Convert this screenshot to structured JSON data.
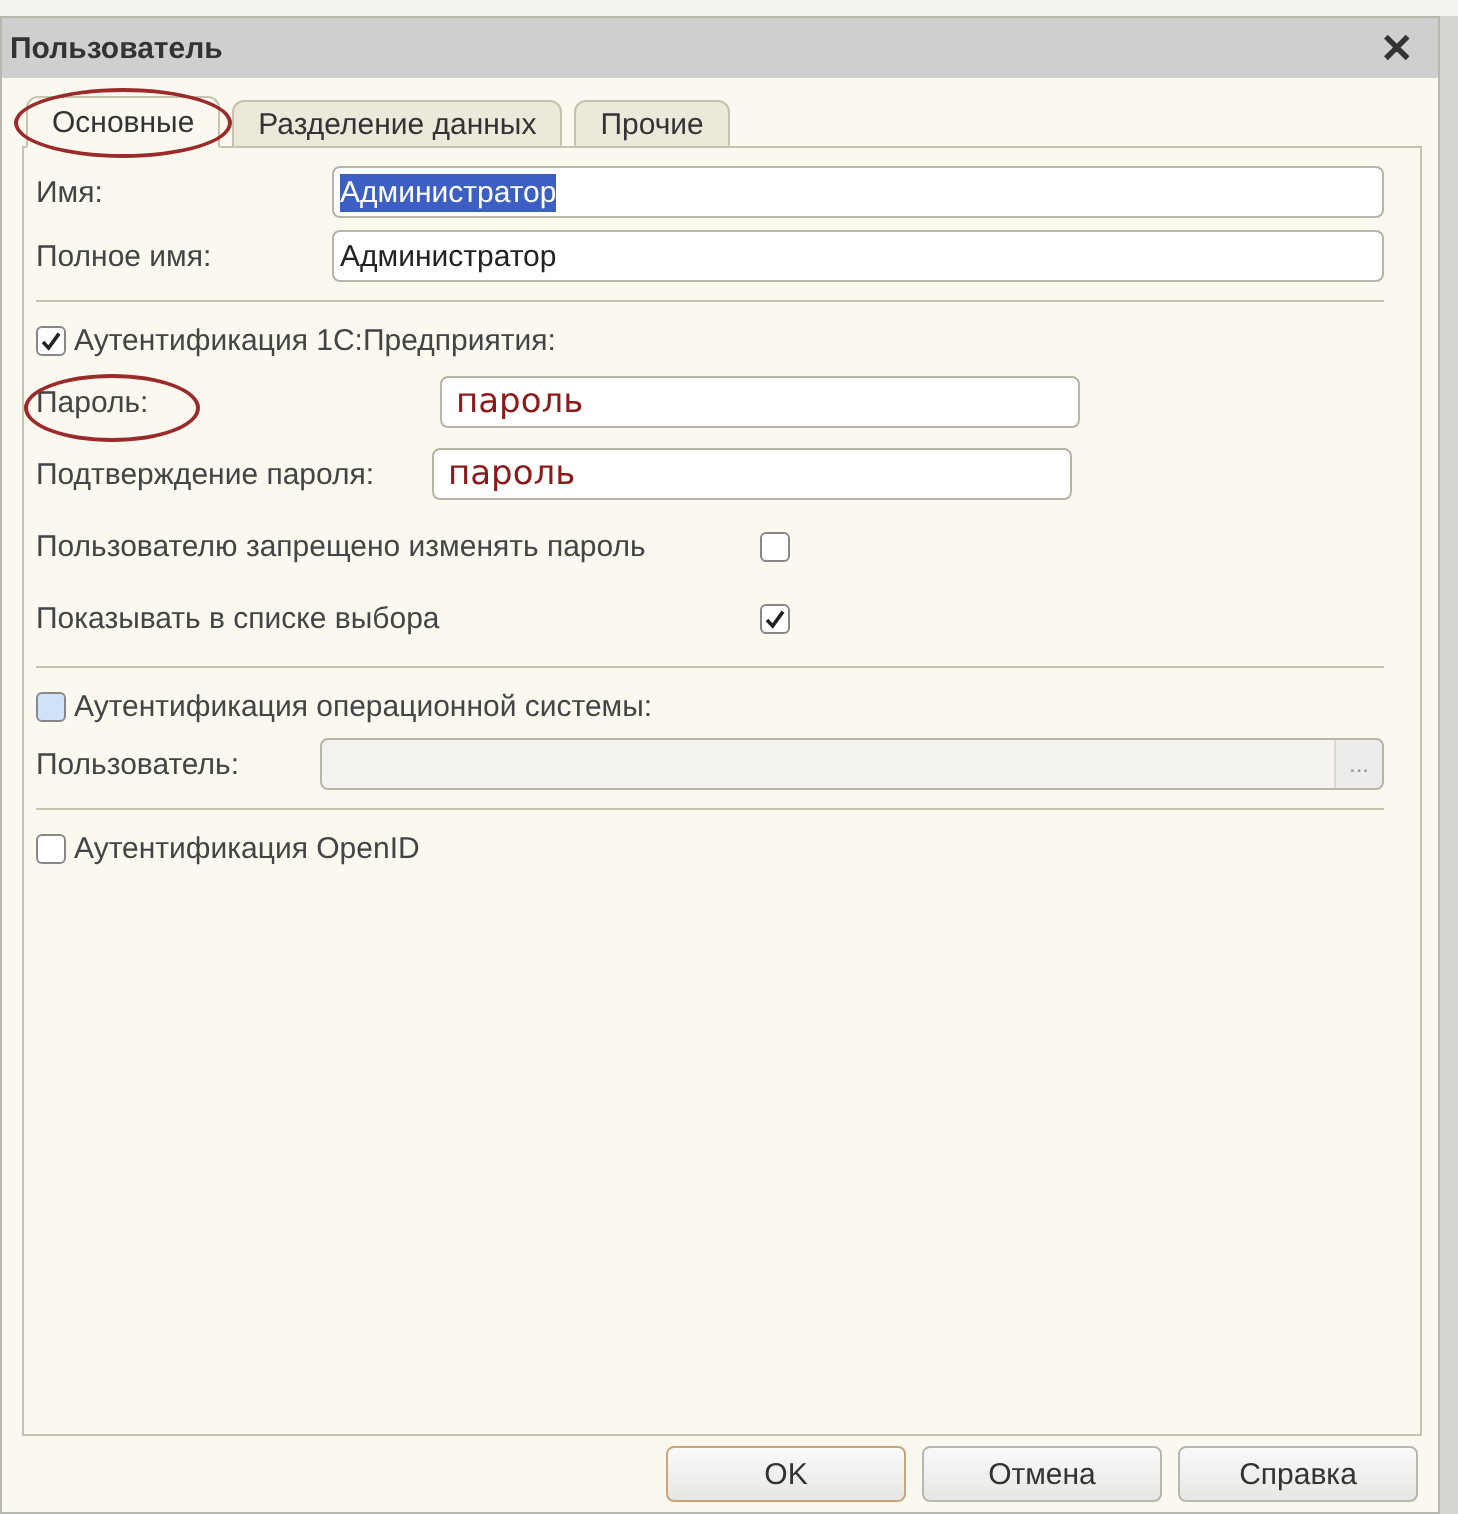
{
  "window": {
    "title": "Пользователь",
    "close": "✕"
  },
  "tabs": [
    {
      "label": "Основные",
      "selected": true,
      "circled": true
    },
    {
      "label": "Разделение данных",
      "selected": false,
      "circled": false
    },
    {
      "label": "Прочие",
      "selected": false,
      "circled": false
    }
  ],
  "name_fields": [
    {
      "label": "Имя:",
      "value": "Администратор",
      "value_selected": true
    },
    {
      "label": "Полное имя:",
      "value": "Администратор",
      "value_selected": false
    }
  ],
  "auth_1c": {
    "label": "Аутентификация 1С:Предприятия:",
    "checked": true
  },
  "password_fields": [
    {
      "label": "Пароль:",
      "value": "пароль",
      "circled": true
    },
    {
      "label": "Подтверждение пароля:",
      "value": "пароль",
      "circled": false
    }
  ],
  "options": [
    {
      "label": "Пользователю запрещено изменять пароль",
      "checked": false
    },
    {
      "label": "Показывать в списке выбора",
      "checked": true
    }
  ],
  "auth_os": {
    "label": "Аутентификация операционной системы:",
    "checked": false,
    "user_label": "Пользователь:",
    "button": "..."
  },
  "auth_openid": {
    "label": "Аутентификация OpenID",
    "checked": false
  },
  "buttons": [
    {
      "label": "OK",
      "default": true
    },
    {
      "label": "Отмена",
      "default": false
    },
    {
      "label": "Справка",
      "default": false
    }
  ]
}
